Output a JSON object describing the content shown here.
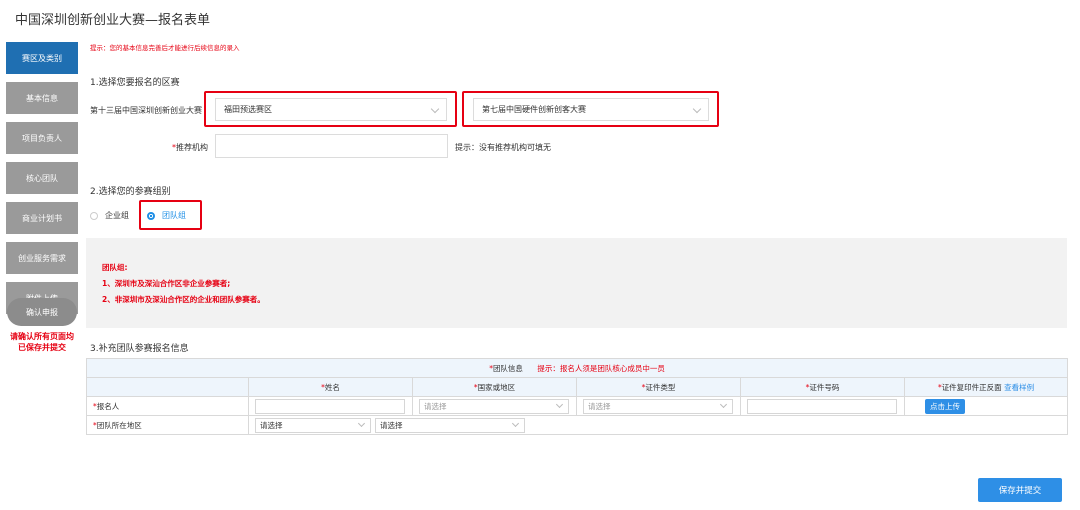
{
  "page_title": "中国深圳创新创业大赛—报名表单",
  "sidebar": {
    "items": [
      {
        "label": "赛区及类别",
        "active": true
      },
      {
        "label": "基本信息"
      },
      {
        "label": "项目负责人"
      },
      {
        "label": "核心团队"
      },
      {
        "label": "商业计划书"
      },
      {
        "label": "创业服务需求"
      },
      {
        "label": "附件上传"
      }
    ],
    "confirm_label": "确认申报",
    "confirm_note_line1": "请确认所有页面均",
    "confirm_note_line2": "已保存并提交"
  },
  "tip": "提示：您的基本信息完善后才能进行后续信息的录入",
  "section1": {
    "title": "1.选择您要报名的区赛",
    "contest_label": "第十三届中国深圳创新创业大赛",
    "district_value": "福田预选赛区",
    "category_value": "第七届中国硬件创新创客大赛",
    "recommend_label": "推荐机构",
    "recommend_hint": "提示：没有推荐机构可填无"
  },
  "section2": {
    "title": "2.选择您的参赛组别",
    "option_enterprise": "企业组",
    "option_team": "团队组",
    "selected": "团队组",
    "info_title": "团队组:",
    "info_line1": "1、深圳市及深汕合作区非企业参赛者;",
    "info_line2": "2、非深圳市及深汕合作区的企业和团队参赛者。"
  },
  "section3": {
    "title": "3.补充团队参赛报名信息",
    "group_header": "团队信息",
    "group_hint": "提示：报名人须是团队核心成员中一员",
    "columns": [
      "姓名",
      "国家或地区",
      "证件类型",
      "证件号码",
      "证件复印件正反面"
    ],
    "view_sample": "查看样例",
    "row_applicant": "报名人",
    "row_region": "团队所在地区",
    "placeholder_select": "请选择",
    "upload_label": "点击上传"
  },
  "save_label": "保存并提交",
  "colors": {
    "accent": "#2e8fe6",
    "sidebar_active": "#1f6fb2",
    "alert": "#e60012"
  }
}
